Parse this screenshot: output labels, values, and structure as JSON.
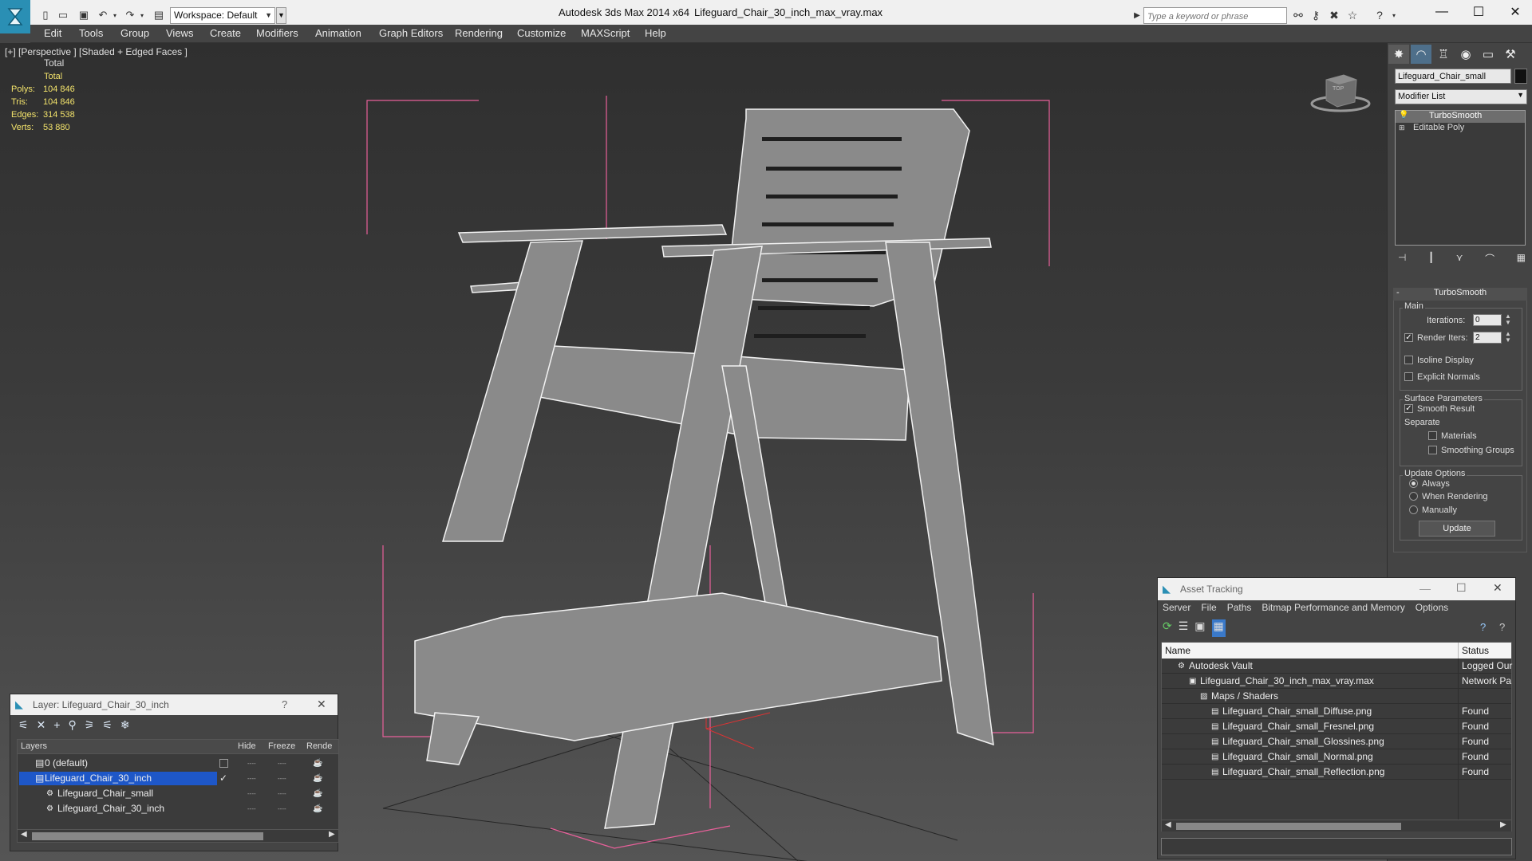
{
  "titlebar": {
    "workspace": "Workspace: Default",
    "app_title": "Autodesk 3ds Max  2014 x64",
    "file_title": "Lifeguard_Chair_30_inch_max_vray.max",
    "search_placeholder": "Type a keyword or phrase"
  },
  "menu": [
    "Edit",
    "Tools",
    "Group",
    "Views",
    "Create",
    "Modifiers",
    "Animation",
    "Graph Editors",
    "Rendering",
    "Customize",
    "MAXScript",
    "Help"
  ],
  "viewport": {
    "label": "[+] [Perspective ] [Shaded + Edged Faces ]",
    "stats_header": "Total",
    "stats": [
      {
        "label": "Polys:",
        "value": "104 846"
      },
      {
        "label": "Tris:",
        "value": "104 846"
      },
      {
        "label": "Edges:",
        "value": "314 538"
      },
      {
        "label": "Verts:",
        "value": "53 880"
      }
    ],
    "viewcube_top": "TOP",
    "wire_color": "#f2f2f2",
    "bbox_color": "#e8609a"
  },
  "command_panel": {
    "object_name": "Lifeguard_Chair_small",
    "modifier_list": "Modifier List",
    "stack": [
      "TurboSmooth",
      "Editable Poly"
    ],
    "rollout_title": "TurboSmooth",
    "main_label": "Main",
    "iterations_label": "Iterations:",
    "iterations_value": "0",
    "render_iters_label": "Render Iters:",
    "render_iters_value": "2",
    "isoline": "Isoline Display",
    "explicit_normals": "Explicit Normals",
    "surface_params": "Surface Parameters",
    "smooth_result": "Smooth Result",
    "separate": "Separate",
    "materials": "Materials",
    "smoothing_groups": "Smoothing Groups",
    "update_options": "Update Options",
    "always": "Always",
    "when_rendering": "When Rendering",
    "manually": "Manually",
    "update_button": "Update"
  },
  "layer_window": {
    "title": "Layer: Lifeguard_Chair_30_inch",
    "help": "?",
    "columns": {
      "layers": "Layers",
      "hide": "Hide",
      "freeze": "Freeze",
      "render": "Rende"
    },
    "rows": [
      {
        "name": "0 (default)",
        "indent": 0,
        "selected": false
      },
      {
        "name": "Lifeguard_Chair_30_inch",
        "indent": 0,
        "selected": true
      },
      {
        "name": "Lifeguard_Chair_small",
        "indent": 1,
        "selected": false
      },
      {
        "name": "Lifeguard_Chair_30_inch",
        "indent": 1,
        "selected": false
      }
    ],
    "hide_mark": "----",
    "freeze_mark": "----"
  },
  "asset_window": {
    "title": "Asset Tracking",
    "menu": [
      "Server",
      "File",
      "Paths",
      "Bitmap Performance and Memory",
      "Options"
    ],
    "col_name": "Name",
    "col_status": "Status",
    "rows": [
      {
        "name": "Autodesk Vault",
        "status": "Logged Our",
        "indent": 1
      },
      {
        "name": "Lifeguard_Chair_30_inch_max_vray.max",
        "status": "Network Pa",
        "indent": 2
      },
      {
        "name": "Maps / Shaders",
        "status": "",
        "indent": 3
      },
      {
        "name": "Lifeguard_Chair_small_Diffuse.png",
        "status": "Found",
        "indent": 4
      },
      {
        "name": "Lifeguard_Chair_small_Fresnel.png",
        "status": "Found",
        "indent": 4
      },
      {
        "name": "Lifeguard_Chair_small_Glossines.png",
        "status": "Found",
        "indent": 4
      },
      {
        "name": "Lifeguard_Chair_small_Normal.png",
        "status": "Found",
        "indent": 4
      },
      {
        "name": "Lifeguard_Chair_small_Reflection.png",
        "status": "Found",
        "indent": 4
      }
    ]
  },
  "icons": {
    "new": "new-file-icon",
    "open": "open-icon",
    "save": "save-icon",
    "undo": "undo-icon",
    "redo": "redo-icon",
    "binoculars": "binoculars-icon",
    "key": "key-icon",
    "star": "star-icon",
    "help": "help-icon"
  }
}
